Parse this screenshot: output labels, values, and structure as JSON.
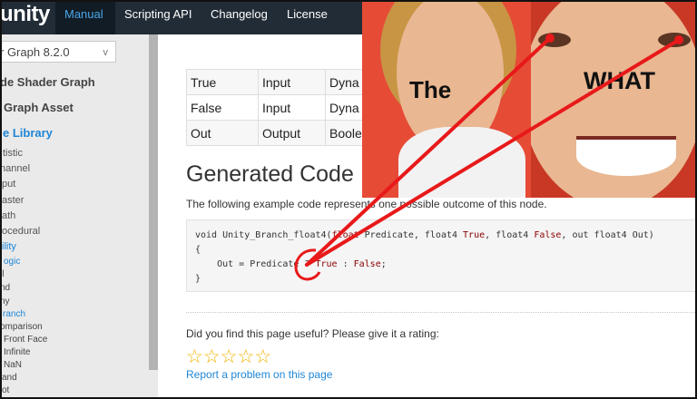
{
  "topbar": {
    "logo": "unity",
    "nav": [
      "Manual",
      "Scripting API",
      "Changelog",
      "License"
    ]
  },
  "sidebar": {
    "version": "r Graph 8.2.0",
    "version_chevron": "v",
    "items": [
      "de Shader Graph",
      "Graph Asset",
      "e Library",
      "tistic",
      "nannel",
      "put",
      "aster",
      "ath",
      "ocedural",
      "ility",
      "ogic",
      "ll",
      "nd",
      "ny",
      "ranch",
      "omparison",
      "Front Face",
      "Infinite",
      "NaN",
      "and",
      "ot"
    ]
  },
  "ports_table": [
    [
      "True",
      "Input",
      "Dyna"
    ],
    [
      "False",
      "Input",
      "Dyna"
    ],
    [
      "Out",
      "Output",
      "Boole"
    ]
  ],
  "generated_code": {
    "heading": "Generated Code",
    "intro": "The following example code represents one possible outcome of this node.",
    "code": {
      "l1_void": "void",
      "l1_fn": " Unity_Branch_float4(",
      "l1_float": "float",
      "l1_pred": " Predicate, float4 ",
      "l1_true": "True",
      "l1_comma1": ", float4 ",
      "l1_false": "False",
      "l1_comma2": ", ",
      "l1_out": "out",
      "l1_tail": " float4 Out)",
      "l2": "{",
      "l3_a": "    Out = Predicate ? ",
      "l3_true": "True",
      "l3_mid": " : ",
      "l3_false": "False",
      "l3_end": ";",
      "l4": "}"
    }
  },
  "rating": {
    "question": "Did you find this page useful? Please give it a rating:",
    "stars": [
      "☆",
      "☆",
      "☆",
      "☆",
      "☆"
    ],
    "report": "Report a problem on this page"
  },
  "meme": {
    "left_caption": "The",
    "right_caption": "WHAT"
  },
  "colors": {
    "nav_bg": "#222c37",
    "link_blue": "#1f86d6",
    "annotation_red": "#e8191a",
    "star": "#f0b400"
  }
}
